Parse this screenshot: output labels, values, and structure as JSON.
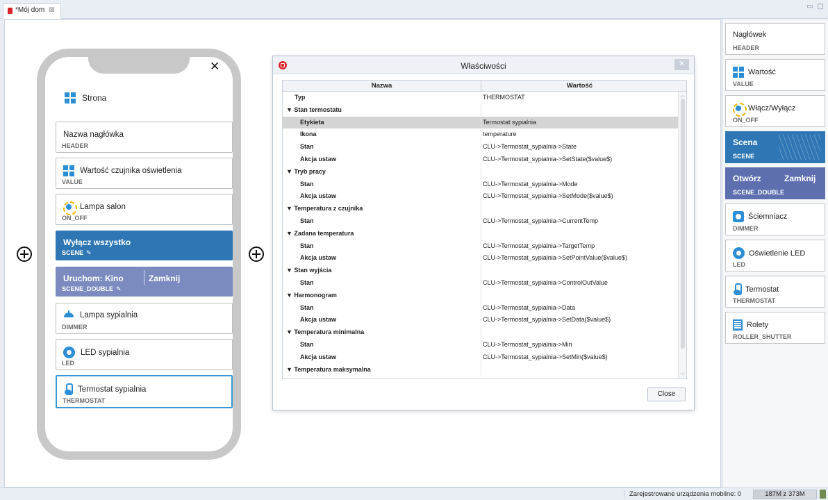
{
  "editor": {
    "tab_label": "*Mój dom",
    "tab_close": "⊠",
    "win_minimize": "▭",
    "win_maximize": "▢"
  },
  "phone": {
    "close": "✕",
    "page": {
      "label": "Strona",
      "icon": "grid-icon"
    },
    "tiles": [
      {
        "label": "Nazwa nagłówka",
        "type": "HEADER",
        "icon": ""
      },
      {
        "label": "Wartość czujnika oświetlenia",
        "type": "VALUE",
        "icon": "grid-icon"
      },
      {
        "label": "Lampa salon",
        "type": "ON_OFF",
        "icon": "bulb-icon"
      },
      {
        "label": "Wyłącz wszystko",
        "type": "SCENE",
        "icon": "pencil-icon"
      },
      {
        "label": "Uruchom: Kino",
        "label2": "Zamknij",
        "type": "SCENE_DOUBLE",
        "icon": "pencil-icon"
      },
      {
        "label": "Lampa sypialnia",
        "type": "DIMMER",
        "icon": "lamp-icon"
      },
      {
        "label": "LED sypialnia",
        "type": "LED",
        "icon": "led-icon"
      },
      {
        "label": "Termostat sypialnia",
        "type": "THERMOSTAT",
        "icon": "thermometer-icon"
      }
    ]
  },
  "dialog": {
    "title": "Właściwości",
    "close": "✕",
    "col_name": "Nazwa",
    "col_value": "Wartość",
    "rows": [
      {
        "name": "Typ",
        "value": "THERMOSTAT",
        "kind": "top"
      },
      {
        "name": "▼  Stan termostatu",
        "value": "",
        "kind": "cat"
      },
      {
        "name": "Etykieta",
        "value": "Termostat sypialnia",
        "kind": "item",
        "selected": true
      },
      {
        "name": "Ikona",
        "value": "temperature",
        "kind": "item"
      },
      {
        "name": "Stan",
        "value": "CLU->Termostat_sypialnia->State",
        "kind": "item"
      },
      {
        "name": "Akcja ustaw",
        "value": "CLU->Termostat_sypialnia->SetState($value$)",
        "kind": "item"
      },
      {
        "name": "▼  Tryb pracy",
        "value": "",
        "kind": "cat"
      },
      {
        "name": "Stan",
        "value": "CLU->Termostat_sypialnia->Mode",
        "kind": "item"
      },
      {
        "name": "Akcja ustaw",
        "value": "CLU->Termostat_sypialnia->SetMode($value$)",
        "kind": "item"
      },
      {
        "name": "▼  Temperatura z czujnika",
        "value": "",
        "kind": "cat"
      },
      {
        "name": "Stan",
        "value": "CLU->Termostat_sypialnia->CurrentTemp",
        "kind": "item"
      },
      {
        "name": "▼  Zadana temperatura",
        "value": "",
        "kind": "cat"
      },
      {
        "name": "Stan",
        "value": "CLU->Termostat_sypialnia->TargetTemp",
        "kind": "item"
      },
      {
        "name": "Akcja ustaw",
        "value": "CLU->Termostat_sypialnia->SetPointValue($value$)",
        "kind": "item"
      },
      {
        "name": "▼  Stan wyjścia",
        "value": "",
        "kind": "cat"
      },
      {
        "name": "Stan",
        "value": "CLU->Termostat_sypialnia->ControlOutValue",
        "kind": "item"
      },
      {
        "name": "▼  Harmonogram",
        "value": "",
        "kind": "cat"
      },
      {
        "name": "Stan",
        "value": "CLU->Termostat_sypialnia->Data",
        "kind": "item"
      },
      {
        "name": "Akcja ustaw",
        "value": "CLU->Termostat_sypialnia->SetData($value$)",
        "kind": "item"
      },
      {
        "name": "▼  Temperatura minimalna",
        "value": "",
        "kind": "cat"
      },
      {
        "name": "Stan",
        "value": "CLU->Termostat_sypialnia->Min",
        "kind": "item"
      },
      {
        "name": "Akcja ustaw",
        "value": "CLU->Termostat_sypialnia->SetMin($value$)",
        "kind": "item"
      },
      {
        "name": "▼  Temperatura maksymalna",
        "value": "",
        "kind": "cat"
      }
    ],
    "close_button": "Close"
  },
  "palette": {
    "items": [
      {
        "label": "Nagłówek",
        "type": "HEADER",
        "icon": ""
      },
      {
        "label": "Wartość",
        "type": "VALUE",
        "icon": "grid-icon"
      },
      {
        "label": "Włącz/Wyłącz",
        "type": "ON_OFF",
        "icon": "bulb-icon"
      },
      {
        "label": "Scena",
        "type": "SCENE",
        "icon": ""
      },
      {
        "label": "Otwórz",
        "label2": "Zamknij",
        "type": "SCENE_DOUBLE",
        "icon": ""
      },
      {
        "label": "Ściemniacz",
        "type": "DIMMER",
        "icon": "dimmer-icon"
      },
      {
        "label": "Oświetlenie LED",
        "type": "LED",
        "icon": "led-icon"
      },
      {
        "label": "Termostat",
        "type": "THERMOSTAT",
        "icon": "thermometer-icon"
      },
      {
        "label": "Rolety",
        "type": "ROLLER_SHUTTER",
        "icon": "roller-shutter-icon"
      }
    ]
  },
  "status": {
    "devices": "Zarejestrowane urządzenia mobilne: 0",
    "memory": "187M z 373M",
    "memory_used_fraction": 0.5
  },
  "colors": {
    "accent_blue": "#2c8ed6",
    "scene_blue": "#2f77b4",
    "scene_double": "#7c8bbf",
    "selection_border": "#3a9ad9",
    "brand_red": "#d9252a"
  }
}
